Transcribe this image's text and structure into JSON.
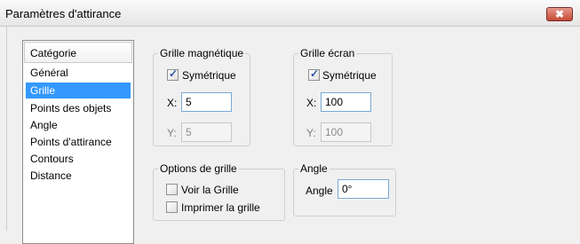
{
  "window": {
    "title": "Paramètres d'attirance",
    "close_glyph": "✖"
  },
  "category": {
    "header": "Catégorie",
    "items": [
      "Général",
      "Grille",
      "Points des objets",
      "Angle",
      "Points d'attirance",
      "Contours",
      "Distance"
    ],
    "selected": "Grille"
  },
  "magnetic_grid": {
    "legend": "Grille magnétique",
    "symmetric_label": "Symétrique",
    "symmetric_checked": true,
    "x_label": "X:",
    "x_value": "5",
    "y_label": "Y:",
    "y_value": "5"
  },
  "screen_grid": {
    "legend": "Grille écran",
    "symmetric_label": "Symétrique",
    "symmetric_checked": true,
    "x_label": "X:",
    "x_value": "100",
    "y_label": "Y:",
    "y_value": "100"
  },
  "grid_options": {
    "legend": "Options de grille",
    "show_grid_label": "Voir la Grille",
    "show_grid_checked": false,
    "print_grid_label": "Imprimer la grille",
    "print_grid_checked": false
  },
  "angle": {
    "legend": "Angle",
    "label": "Angle",
    "value": "0°"
  },
  "colors": {
    "selection": "#3399ff",
    "close_button": "#c44a36"
  },
  "icons": {
    "checkmark": "✓"
  }
}
